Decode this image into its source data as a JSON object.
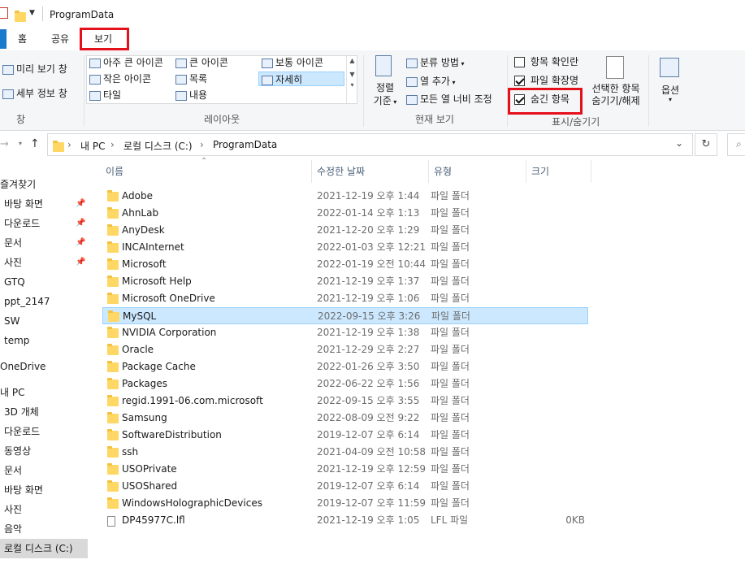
{
  "window": {
    "title": "ProgramData"
  },
  "tabs": [
    {
      "label": "홈"
    },
    {
      "label": "공유"
    },
    {
      "label": "보기"
    }
  ],
  "ribbon": {
    "pane": {
      "preview": "미리 보기 창",
      "details": "세부 정보 창",
      "group": "창"
    },
    "layout": {
      "items": [
        "아주 큰 아이콘",
        "큰 아이콘",
        "보통 아이콘",
        "작은 아이콘",
        "목록",
        "자세히",
        "타일",
        "내용"
      ],
      "group": "레이아웃"
    },
    "current_view": {
      "sort": "정렬\n기준",
      "sort_line1": "정렬",
      "sort_line2": "기준",
      "group_by": "분류 방법",
      "add_column": "열 추가",
      "fit_columns": "모든 열 너비 조정",
      "group": "현재 보기"
    },
    "show_hide": {
      "item_checkbox": "항목 확인란",
      "file_ext": "파일 확장명",
      "hidden_items": "숨긴 항목",
      "hide_selected_line1": "선택한 항목",
      "hide_selected_line2": "숨기기/해제",
      "group": "표시/숨기기",
      "checks": {
        "item_checkbox": false,
        "file_ext": true,
        "hidden_items": true
      }
    },
    "options": "옵션"
  },
  "address": {
    "crumbs": [
      "내 PC",
      "로컬 디스크 (C:)",
      "ProgramData"
    ]
  },
  "nav": {
    "quick_access": "즐겨찾기",
    "quick_items": [
      "바탕 화면",
      "다운로드",
      "문서",
      "사진",
      "GTQ",
      "ppt_2147",
      "SW",
      "temp"
    ],
    "onedrive": "OneDrive",
    "pc": "내 PC",
    "pc_items": [
      "3D 개체",
      "다운로드",
      "동영상",
      "문서",
      "바탕 화면",
      "사진",
      "음악",
      "로컬 디스크 (C:)"
    ]
  },
  "columns": {
    "name": "이름",
    "date": "수정한 날짜",
    "type": "유형",
    "size": "크기"
  },
  "files": [
    {
      "name": "Adobe",
      "date": "2021-12-19 오후 1:44",
      "type": "파일 폴더",
      "size": ""
    },
    {
      "name": "AhnLab",
      "date": "2022-01-14 오후 1:13",
      "type": "파일 폴더",
      "size": ""
    },
    {
      "name": "AnyDesk",
      "date": "2021-12-20 오후 1:29",
      "type": "파일 폴더",
      "size": ""
    },
    {
      "name": "INCAInternet",
      "date": "2022-01-03 오후 12:21",
      "type": "파일 폴더",
      "size": ""
    },
    {
      "name": "Microsoft",
      "date": "2022-01-19 오전 10:44",
      "type": "파일 폴더",
      "size": ""
    },
    {
      "name": "Microsoft Help",
      "date": "2021-12-19 오후 1:37",
      "type": "파일 폴더",
      "size": ""
    },
    {
      "name": "Microsoft OneDrive",
      "date": "2021-12-19 오후 1:06",
      "type": "파일 폴더",
      "size": ""
    },
    {
      "name": "MySQL",
      "date": "2022-09-15 오후 3:26",
      "type": "파일 폴더",
      "size": ""
    },
    {
      "name": "NVIDIA Corporation",
      "date": "2021-12-19 오후 1:38",
      "type": "파일 폴더",
      "size": ""
    },
    {
      "name": "Oracle",
      "date": "2021-12-29 오후 2:27",
      "type": "파일 폴더",
      "size": ""
    },
    {
      "name": "Package Cache",
      "date": "2022-01-26 오후 3:50",
      "type": "파일 폴더",
      "size": ""
    },
    {
      "name": "Packages",
      "date": "2022-06-22 오후 1:56",
      "type": "파일 폴더",
      "size": ""
    },
    {
      "name": "regid.1991-06.com.microsoft",
      "date": "2022-09-15 오후 3:55",
      "type": "파일 폴더",
      "size": ""
    },
    {
      "name": "Samsung",
      "date": "2022-08-09 오전 9:22",
      "type": "파일 폴더",
      "size": ""
    },
    {
      "name": "SoftwareDistribution",
      "date": "2019-12-07 오후 6:14",
      "type": "파일 폴더",
      "size": ""
    },
    {
      "name": "ssh",
      "date": "2021-04-09 오전 10:58",
      "type": "파일 폴더",
      "size": ""
    },
    {
      "name": "USOPrivate",
      "date": "2021-12-19 오후 12:59",
      "type": "파일 폴더",
      "size": ""
    },
    {
      "name": "USOShared",
      "date": "2019-12-07 오후 6:14",
      "type": "파일 폴더",
      "size": ""
    },
    {
      "name": "WindowsHolographicDevices",
      "date": "2019-12-07 오후 11:59",
      "type": "파일 폴더",
      "size": ""
    },
    {
      "name": "DP45977C.lfl",
      "date": "2021-12-19 오후 1:05",
      "type": "LFL 파일",
      "size": "0KB"
    }
  ],
  "colors": {
    "highlight": "#e4101a",
    "selection": "#cce8ff",
    "folder": "#ffd764"
  }
}
